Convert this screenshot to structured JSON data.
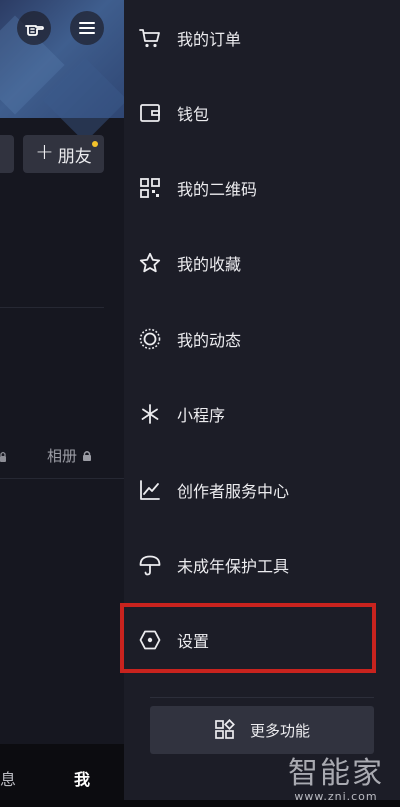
{
  "left_panel": {
    "friend_button": {
      "plus": "+",
      "label": "朋友"
    },
    "tabs": {
      "album": "相册"
    },
    "bottom_nav": {
      "message_partial": "息",
      "me": "我"
    }
  },
  "drawer": {
    "items": [
      {
        "label": "我的订单",
        "icon": "cart-icon"
      },
      {
        "label": "钱包",
        "icon": "wallet-icon"
      },
      {
        "label": "我的二维码",
        "icon": "qrcode-icon"
      },
      {
        "label": "我的收藏",
        "icon": "star-icon"
      },
      {
        "label": "我的动态",
        "icon": "dynamic-circle-icon"
      },
      {
        "label": "小程序",
        "icon": "mini-program-icon"
      },
      {
        "label": "创作者服务中心",
        "icon": "chart-icon"
      },
      {
        "label": "未成年保护工具",
        "icon": "umbrella-icon"
      },
      {
        "label": "设置",
        "icon": "settings-hexagon-icon"
      }
    ],
    "more_button": {
      "label": "更多功能",
      "icon": "grid-shapes-icon"
    }
  },
  "watermark": {
    "main": "智能家",
    "sub": "www.znj.com"
  },
  "colors": {
    "drawer_bg": "#1c1d27",
    "highlight": "#c8231e",
    "badge": "#f3c22b"
  }
}
